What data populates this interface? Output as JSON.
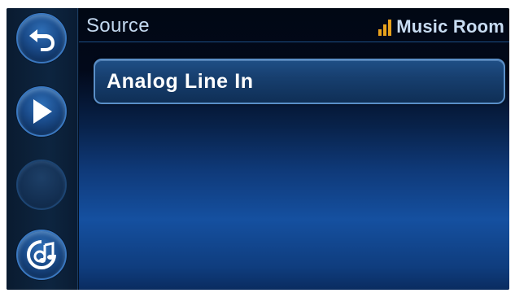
{
  "header": {
    "title": "Source",
    "room_name": "Music Room",
    "signal_level": 3,
    "signal_max": 3
  },
  "rail": {
    "back_icon": "back-arrow-icon",
    "play_icon": "play-icon",
    "music_icon": "music-note-icon"
  },
  "sources": [
    {
      "label": "Analog Line In"
    }
  ],
  "colors": {
    "accent": "#2f6fb7",
    "signal": "#e8a21d",
    "text": "#ffffff"
  }
}
